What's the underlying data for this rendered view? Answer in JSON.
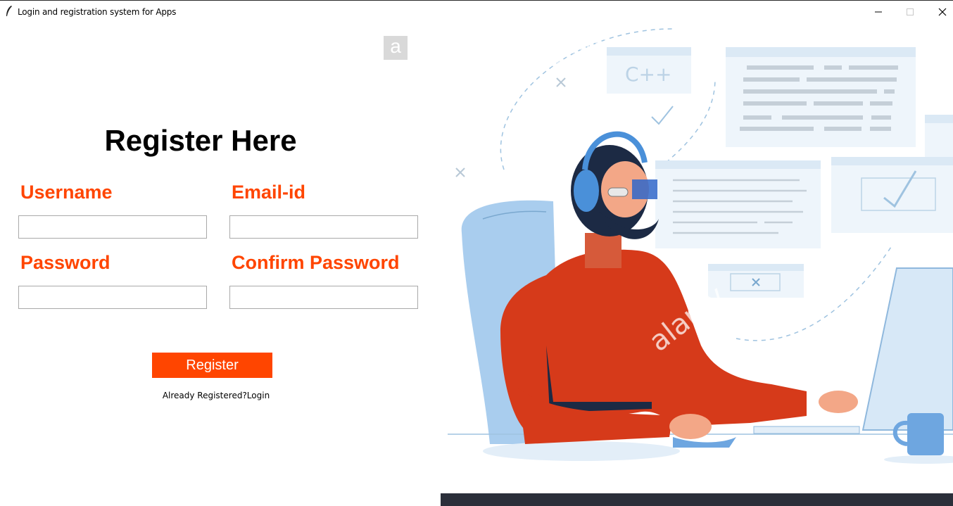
{
  "window": {
    "title": "Login and registration system for Apps",
    "icon": "feather-icon",
    "controls": [
      "minimize-icon",
      "maximize-icon",
      "close-icon"
    ]
  },
  "form": {
    "heading": "Register Here",
    "username_label": "Username",
    "email_label": "Email-id",
    "password_label": "Password",
    "confirm_password_label": "Confirm Password",
    "username_value": "",
    "email_value": "",
    "password_value": "",
    "confirm_password_value": "",
    "register_label": "Register",
    "login_link": "Already Registered?Login"
  },
  "illustration": {
    "code_card": "C++",
    "watermark": "alamy",
    "watermark_glyph": "a"
  },
  "colors": {
    "accent": "#ff4500",
    "background": "#ffffff"
  }
}
